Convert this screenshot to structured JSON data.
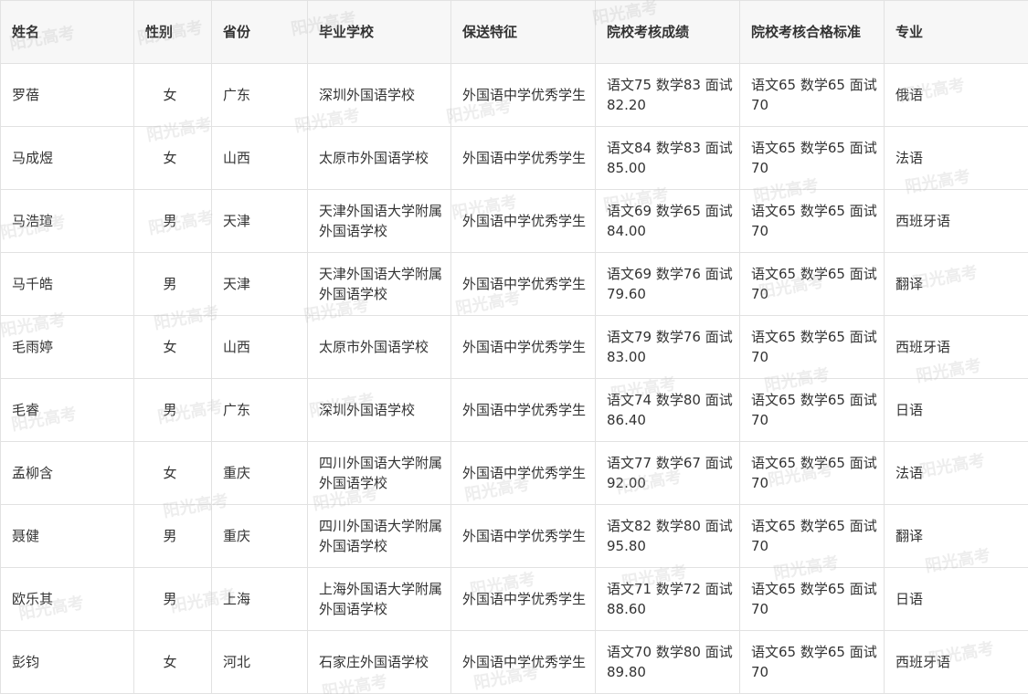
{
  "table": {
    "headers": [
      "姓名",
      "性别",
      "省份",
      "毕业学校",
      "保送特征",
      "院校考核成绩",
      "院校考核合格标准",
      "专业"
    ],
    "rows": [
      [
        "罗蓓",
        "女",
        "广东",
        "深圳外国语学校",
        "外国语中学优秀学生",
        "语文75 数学83 面试82.20",
        "语文65 数学65 面试70",
        "俄语"
      ],
      [
        "马成煜",
        "女",
        "山西",
        "太原市外国语学校",
        "外国语中学优秀学生",
        "语文84 数学83 面试85.00",
        "语文65 数学65 面试70",
        "法语"
      ],
      [
        "马浩瑄",
        "男",
        "天津",
        "天津外国语大学附属外国语学校",
        "外国语中学优秀学生",
        "语文69 数学65 面试84.00",
        "语文65 数学65 面试70",
        "西班牙语"
      ],
      [
        "马千皓",
        "男",
        "天津",
        "天津外国语大学附属外国语学校",
        "外国语中学优秀学生",
        "语文69 数学76 面试79.60",
        "语文65 数学65 面试70",
        "翻译"
      ],
      [
        "毛雨婷",
        "女",
        "山西",
        "太原市外国语学校",
        "外国语中学优秀学生",
        "语文79 数学76 面试83.00",
        "语文65 数学65 面试70",
        "西班牙语"
      ],
      [
        "毛睿",
        "男",
        "广东",
        "深圳外国语学校",
        "外国语中学优秀学生",
        "语文74 数学80 面试86.40",
        "语文65 数学65 面试70",
        "日语"
      ],
      [
        "孟柳含",
        "女",
        "重庆",
        "四川外国语大学附属外国语学校",
        "外国语中学优秀学生",
        "语文77 数学67 面试92.00",
        "语文65 数学65 面试70",
        "法语"
      ],
      [
        "聂健",
        "男",
        "重庆",
        "四川外国语大学附属外国语学校",
        "外国语中学优秀学生",
        "语文82 数学80 面试95.80",
        "语文65 数学65 面试70",
        "翻译"
      ],
      [
        "欧乐其",
        "男",
        "上海",
        "上海外国语大学附属外国语学校",
        "外国语中学优秀学生",
        "语文71 数学72 面试88.60",
        "语文65 数学65 面试70",
        "日语"
      ],
      [
        "彭钧",
        "女",
        "河北",
        "石家庄外国语学校",
        "外国语中学优秀学生",
        "语文70 数学80 面试89.80",
        "语文65 数学65 面试70",
        "西班牙语"
      ]
    ]
  },
  "watermark": {
    "text": "阳光高考",
    "color": "#afafaf"
  }
}
